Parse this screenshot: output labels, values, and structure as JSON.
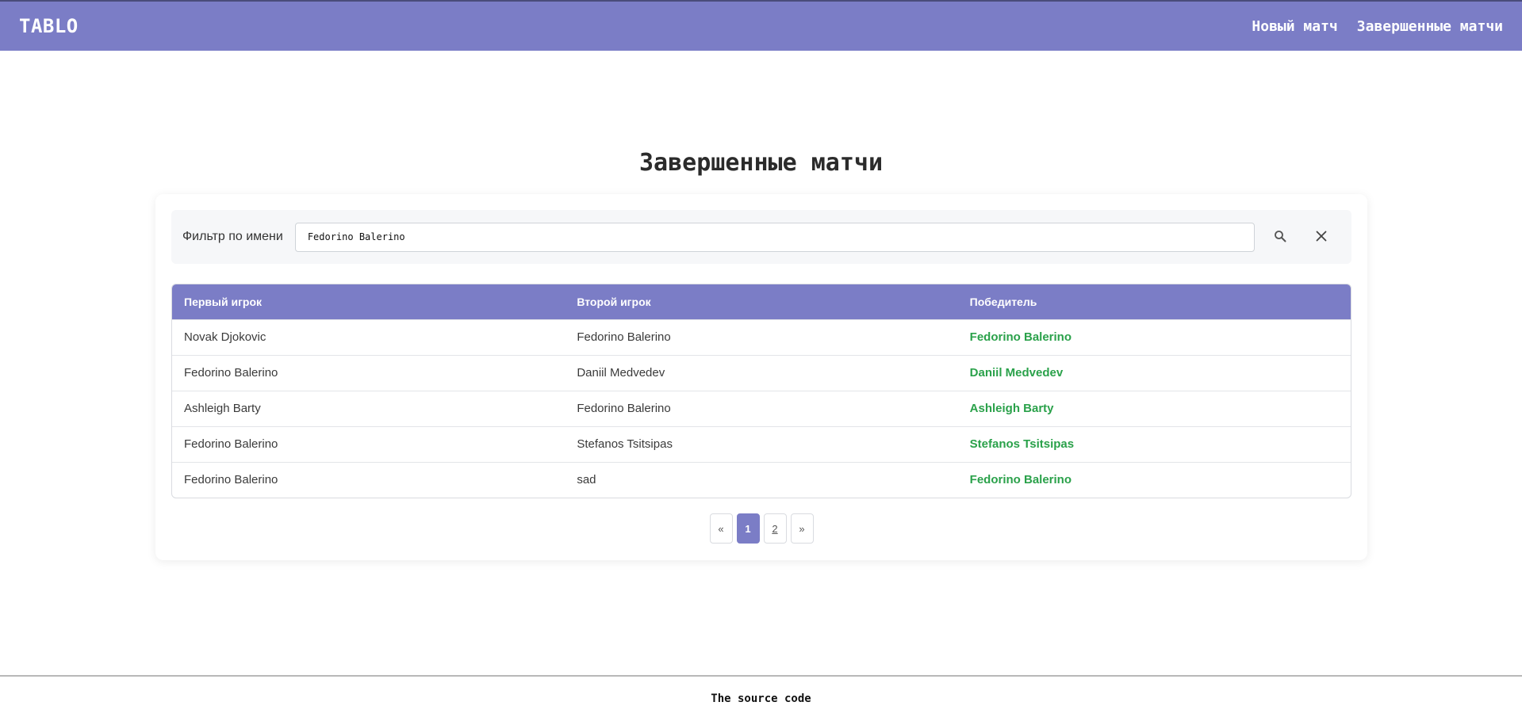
{
  "header": {
    "logo": "TABLO",
    "nav": [
      {
        "label": "Новый матч"
      },
      {
        "label": "Завершенные матчи"
      }
    ]
  },
  "page_title": "Завершенные матчи",
  "filter": {
    "label": "Фильтр по имени",
    "value": "Fedorino Balerino",
    "search_icon": "search-icon",
    "clear_icon": "close-icon"
  },
  "table": {
    "columns": [
      "Первый игрок",
      "Второй игрок",
      "Победитель"
    ],
    "rows": [
      [
        "Novak Djokovic",
        "Fedorino Balerino",
        "Fedorino Balerino"
      ],
      [
        "Fedorino Balerino",
        "Daniil Medvedev",
        "Daniil Medvedev"
      ],
      [
        "Ashleigh Barty",
        "Fedorino Balerino",
        "Ashleigh Barty"
      ],
      [
        "Fedorino Balerino",
        "Stefanos Tsitsipas",
        "Stefanos Tsitsipas"
      ],
      [
        "Fedorino Balerino",
        "sad",
        "Fedorino Balerino"
      ]
    ]
  },
  "pagination": {
    "prev": "«",
    "pages": [
      "1",
      "2"
    ],
    "current": "1",
    "next": "»"
  },
  "footer": {
    "link": "The source code"
  },
  "colors": {
    "accent": "#7b7dc6",
    "winner": "#2aa14a"
  }
}
